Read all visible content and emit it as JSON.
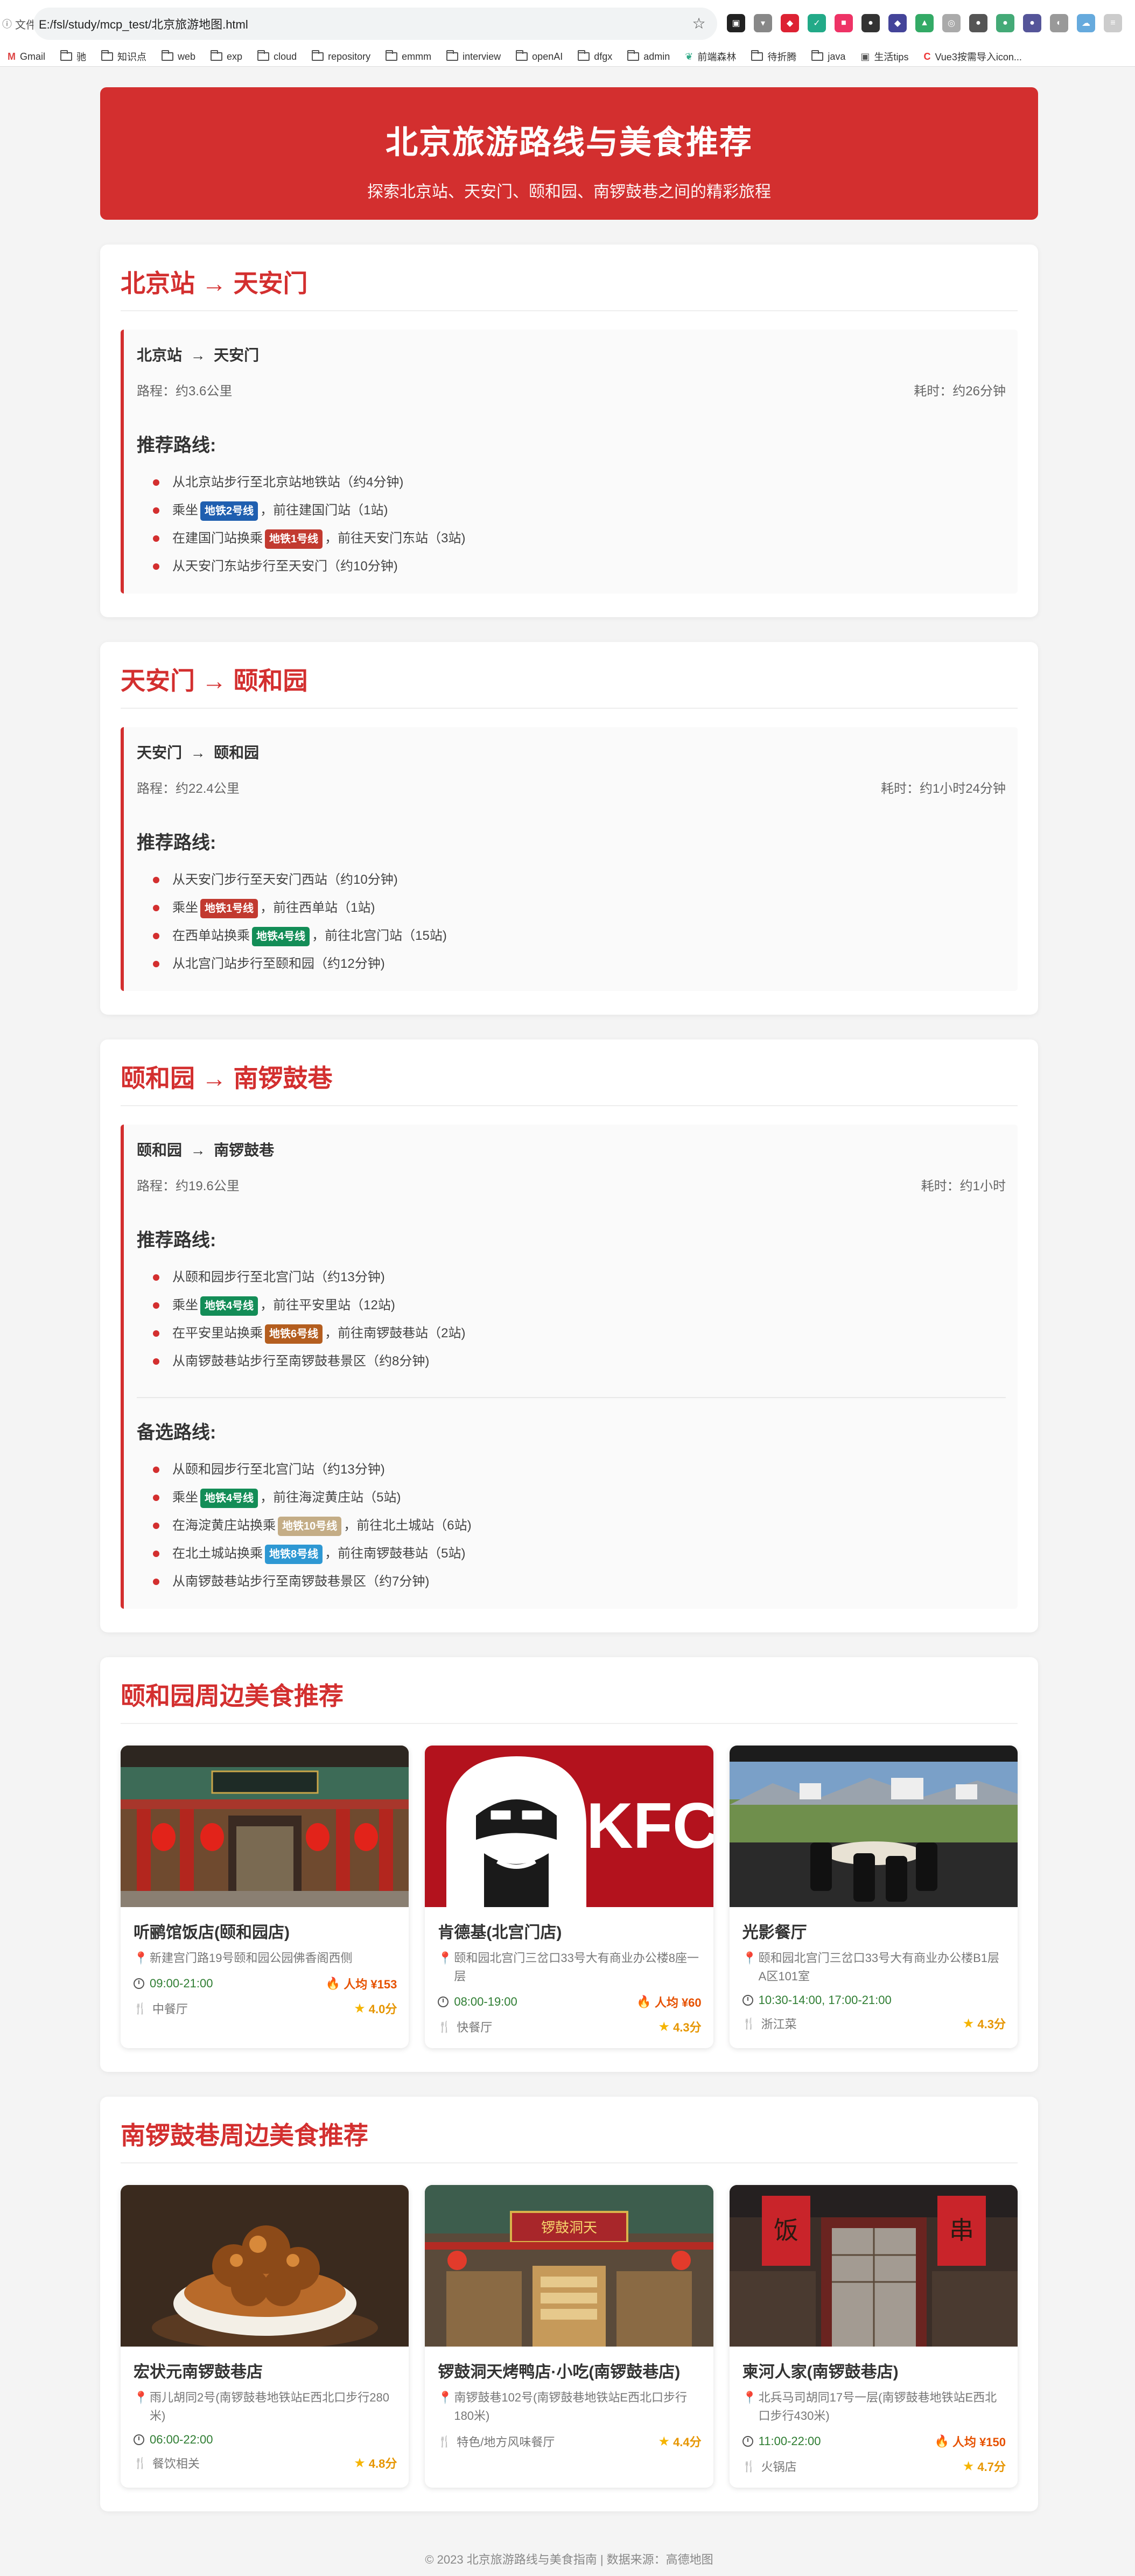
{
  "browser": {
    "file_label": "文件",
    "url": "E:/fsl/study/mcp_test/北京旅游地图.html",
    "bookmarks": [
      "Gmail",
      "驰",
      "知识点",
      "web",
      "exp",
      "cloud",
      "repository",
      "emmm",
      "interview",
      "openAI",
      "dfgx",
      "admin",
      "前端森林",
      "待折腾",
      "java",
      "生活tips",
      "Vue3按需导入icon..."
    ]
  },
  "header": {
    "title": "北京旅游路线与美食推荐",
    "subtitle": "探索北京站、天安门、颐和园、南锣鼓巷之间的精彩旅程"
  },
  "routes": [
    {
      "title": "北京站 → 天安门",
      "from": "北京站",
      "to": "天安门",
      "distance": "路程：约3.6公里",
      "duration": "耗时：约26分钟",
      "sections": [
        {
          "heading": "推荐路线:",
          "steps": [
            {
              "pre": "从北京站步行至北京站地铁站（约4分钟)",
              "tag": "",
              "post": ""
            },
            {
              "pre": "乘坐",
              "tag": "地铁2号线",
              "post": "，前往建国门站（1站)"
            },
            {
              "pre": "在建国门站换乘",
              "tag": "地铁1号线",
              "post": "，前往天安门东站（3站)"
            },
            {
              "pre": "从天安门东站步行至天安门（约10分钟)",
              "tag": "",
              "post": ""
            }
          ]
        }
      ]
    },
    {
      "title": "天安门 → 颐和园",
      "from": "天安门",
      "to": "颐和园",
      "distance": "路程：约22.4公里",
      "duration": "耗时：约1小时24分钟",
      "sections": [
        {
          "heading": "推荐路线:",
          "steps": [
            {
              "pre": "从天安门步行至天安门西站（约10分钟)",
              "tag": "",
              "post": ""
            },
            {
              "pre": "乘坐",
              "tag": "地铁1号线",
              "post": "，前往西单站（1站)"
            },
            {
              "pre": "在西单站换乘",
              "tag": "地铁4号线",
              "post": "，前往北宫门站（15站)"
            },
            {
              "pre": "从北宫门站步行至颐和园（约12分钟)",
              "tag": "",
              "post": ""
            }
          ]
        }
      ]
    },
    {
      "title": "颐和园 → 南锣鼓巷",
      "from": "颐和园",
      "to": "南锣鼓巷",
      "distance": "路程：约19.6公里",
      "duration": "耗时：约1小时",
      "sections": [
        {
          "heading": "推荐路线:",
          "steps": [
            {
              "pre": "从颐和园步行至北宫门站（约13分钟)",
              "tag": "",
              "post": ""
            },
            {
              "pre": "乘坐",
              "tag": "地铁4号线",
              "post": "，前往平安里站（12站)"
            },
            {
              "pre": "在平安里站换乘",
              "tag": "地铁6号线",
              "post": "，前往南锣鼓巷站（2站)"
            },
            {
              "pre": "从南锣鼓巷站步行至南锣鼓巷景区（约8分钟)",
              "tag": "",
              "post": ""
            }
          ]
        },
        {
          "heading": "备选路线:",
          "steps": [
            {
              "pre": "从颐和园步行至北宫门站（约13分钟)",
              "tag": "",
              "post": ""
            },
            {
              "pre": "乘坐",
              "tag": "地铁4号线",
              "post": "，前往海淀黄庄站（5站)"
            },
            {
              "pre": "在海淀黄庄站换乘",
              "tag": "地铁10号线",
              "post": "，前往北土城站（6站)"
            },
            {
              "pre": "在北土城站换乘",
              "tag": "地铁8号线",
              "post": "，前往南锣鼓巷站（5站)"
            },
            {
              "pre": "从南锣鼓巷站步行至南锣鼓巷景区（约7分钟)",
              "tag": "",
              "post": ""
            }
          ]
        }
      ]
    }
  ],
  "food_sections": [
    {
      "title": "颐和园周边美食推荐",
      "items": [
        {
          "name": "听鹂馆饭店(颐和园店)",
          "address": "新建宫门路19号颐和园公园佛香阁西侧",
          "hours": "09:00-21:00",
          "price": "人均 ¥153",
          "category": "中餐厅",
          "rating": "4.0分",
          "image": "palace-gate"
        },
        {
          "name": "肯德基(北宫门店)",
          "address": "颐和园北宫门三岔口33号大有商业办公楼8座一层",
          "hours": "08:00-19:00",
          "price": "人均 ¥60",
          "category": "快餐厅",
          "rating": "4.3分",
          "image": "kfc-logo"
        },
        {
          "name": "光影餐厅",
          "address": "颐和园北宫门三岔口33号大有商业办公楼B1层A区101室",
          "hours": "10:30-14:00, 17:00-21:00",
          "price": "",
          "category": "浙江菜",
          "rating": "4.3分",
          "image": "dining-room"
        }
      ]
    },
    {
      "title": "南锣鼓巷周边美食推荐",
      "items": [
        {
          "name": "宏状元南锣鼓巷店",
          "address": "雨儿胡同2号(南锣鼓巷地铁站E西北口步行280米)",
          "hours": "06:00-22:00",
          "price": "",
          "category": "餐饮相关",
          "rating": "4.8分",
          "image": "braised-dish"
        },
        {
          "name": "锣鼓洞天烤鸭店·小吃(南锣鼓巷店)",
          "address": "南锣鼓巷102号(南锣鼓巷地铁站E西北口步行180米)",
          "hours": "",
          "price": "",
          "category": "特色/地方风味餐厅",
          "rating": "4.4分",
          "image": "shop-front"
        },
        {
          "name": "柬河人家(南锣鼓巷店)",
          "address": "北兵马司胡同17号一层(南锣鼓巷地铁站E西北口步行430米)",
          "hours": "11:00-22:00",
          "price": "人均 ¥150",
          "category": "火锅店",
          "rating": "4.7分",
          "image": "red-door"
        }
      ]
    }
  ],
  "footer": "© 2023 北京旅游路线与美食指南 | 数据来源：高德地图",
  "colors": {
    "accent": "#d32f2f",
    "line1": "#c23a30",
    "line2": "#1f5fb0",
    "line4": "#138d57",
    "line6": "#b45e1f",
    "line8": "#2e98d3",
    "line10": "#c4ad86"
  }
}
